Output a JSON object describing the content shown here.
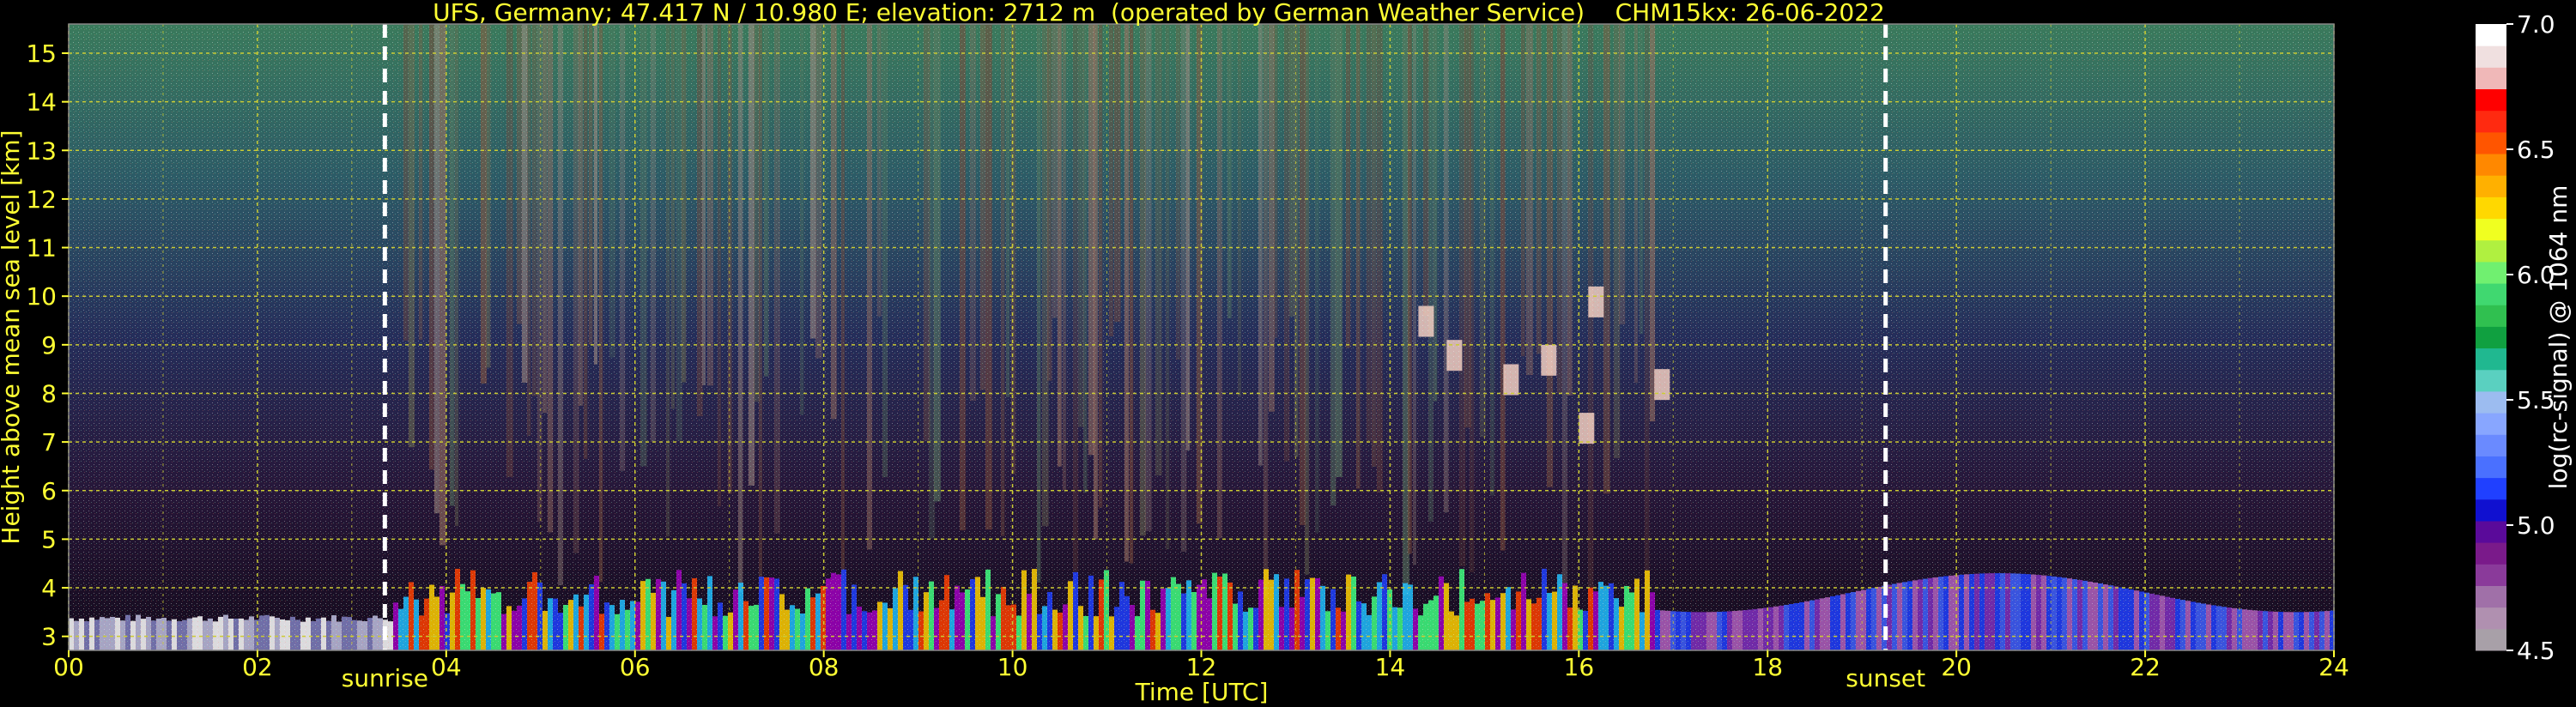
{
  "chart_data": {
    "type": "heatmap",
    "title": "UFS, Germany; 47.417 N / 10.980 E; elevation: 2712 m  (operated by German Weather Service)    CHM15kx: 26-06-2022",
    "xlabel": "Time [UTC]",
    "ylabel": "Height above mean sea level [km]",
    "xlim": [
      0,
      24
    ],
    "ylim": [
      2.712,
      15.6
    ],
    "x_ticks": [
      "00",
      "02",
      "04",
      "06",
      "08",
      "10",
      "12",
      "14",
      "16",
      "18",
      "20",
      "22",
      "24"
    ],
    "x_tick_values": [
      0,
      2,
      4,
      6,
      8,
      10,
      12,
      14,
      16,
      18,
      20,
      22,
      24
    ],
    "y_ticks": [
      "3",
      "4",
      "5",
      "6",
      "7",
      "8",
      "9",
      "10",
      "11",
      "12",
      "13",
      "14",
      "15"
    ],
    "y_tick_values": [
      3,
      4,
      5,
      6,
      7,
      8,
      9,
      10,
      11,
      12,
      13,
      14,
      15
    ],
    "grid": true,
    "markers": [
      {
        "label": "sunrise",
        "time": 3.35
      },
      {
        "label": "sunset",
        "time": 19.25
      }
    ],
    "colorbar": {
      "label": "log(rc-signal) @ 1064 nm",
      "range": [
        4.5,
        7.0
      ],
      "tick_labels": [
        "4.5",
        "5.0",
        "5.5",
        "6.0",
        "6.5",
        "7.0"
      ],
      "tick_values": [
        4.5,
        5.0,
        5.5,
        6.0,
        6.5,
        7.0
      ],
      "colors": [
        "#a8a0a8",
        "#b090b0",
        "#a070a8",
        "#8a3a9a",
        "#7a1a8a",
        "#5a0a9a",
        "#1010d0",
        "#2040ff",
        "#4a70ff",
        "#6a8aff",
        "#88a6ff",
        "#9cbcf0",
        "#5ad0c0",
        "#20b890",
        "#10a040",
        "#30c050",
        "#40d870",
        "#70f070",
        "#b0f040",
        "#f0ff20",
        "#ffd800",
        "#ffb000",
        "#ff8800",
        "#ff5500",
        "#ff2a10",
        "#ff0000",
        "#f0b8b8",
        "#f0e0e0",
        "#ffffff"
      ]
    }
  }
}
